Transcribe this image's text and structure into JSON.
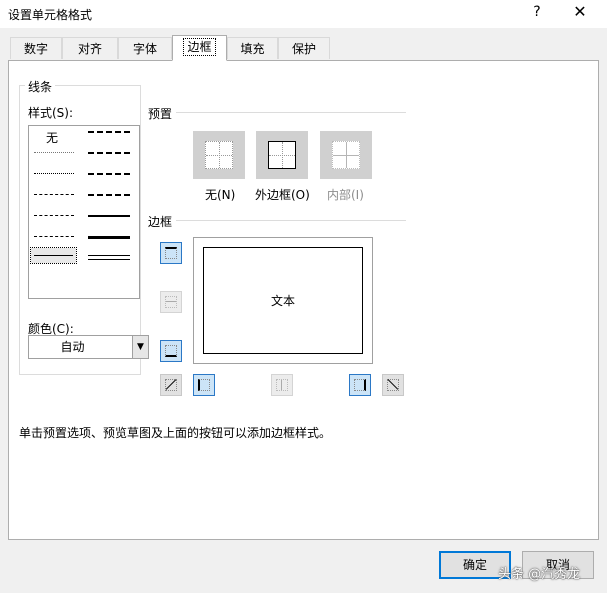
{
  "window": {
    "title": "设置单元格格式",
    "help_icon": "?",
    "close_icon": "✕"
  },
  "tabs": [
    {
      "label": "数字"
    },
    {
      "label": "对齐"
    },
    {
      "label": "字体"
    },
    {
      "label": "边框",
      "active": true
    },
    {
      "label": "填充"
    },
    {
      "label": "保护"
    }
  ],
  "line_group": {
    "title": "线条",
    "style_label": "样式(S):",
    "none_label": "无",
    "color_label": "颜色(C):",
    "color_value": "自动",
    "dropdown_icon": "chevron-down-icon"
  },
  "presets": {
    "title": "预置",
    "items": [
      {
        "label": "无(N)",
        "icon": "border-none-icon"
      },
      {
        "label": "外边框(O)",
        "icon": "border-outline-icon"
      },
      {
        "label": "内部(I)",
        "icon": "border-inside-icon",
        "disabled": true
      }
    ]
  },
  "border": {
    "title": "边框",
    "preview_text": "文本"
  },
  "hint_text": "单击预置选项、预览草图及上面的按钮可以添加边框样式。",
  "buttons": {
    "ok": "确定",
    "cancel": "取消"
  },
  "watermark": "头条 @汽秀龙",
  "colors": {
    "accent": "#0078d7",
    "selected_fill": "#cce4f7",
    "disabled_text": "#8d8d8d"
  }
}
